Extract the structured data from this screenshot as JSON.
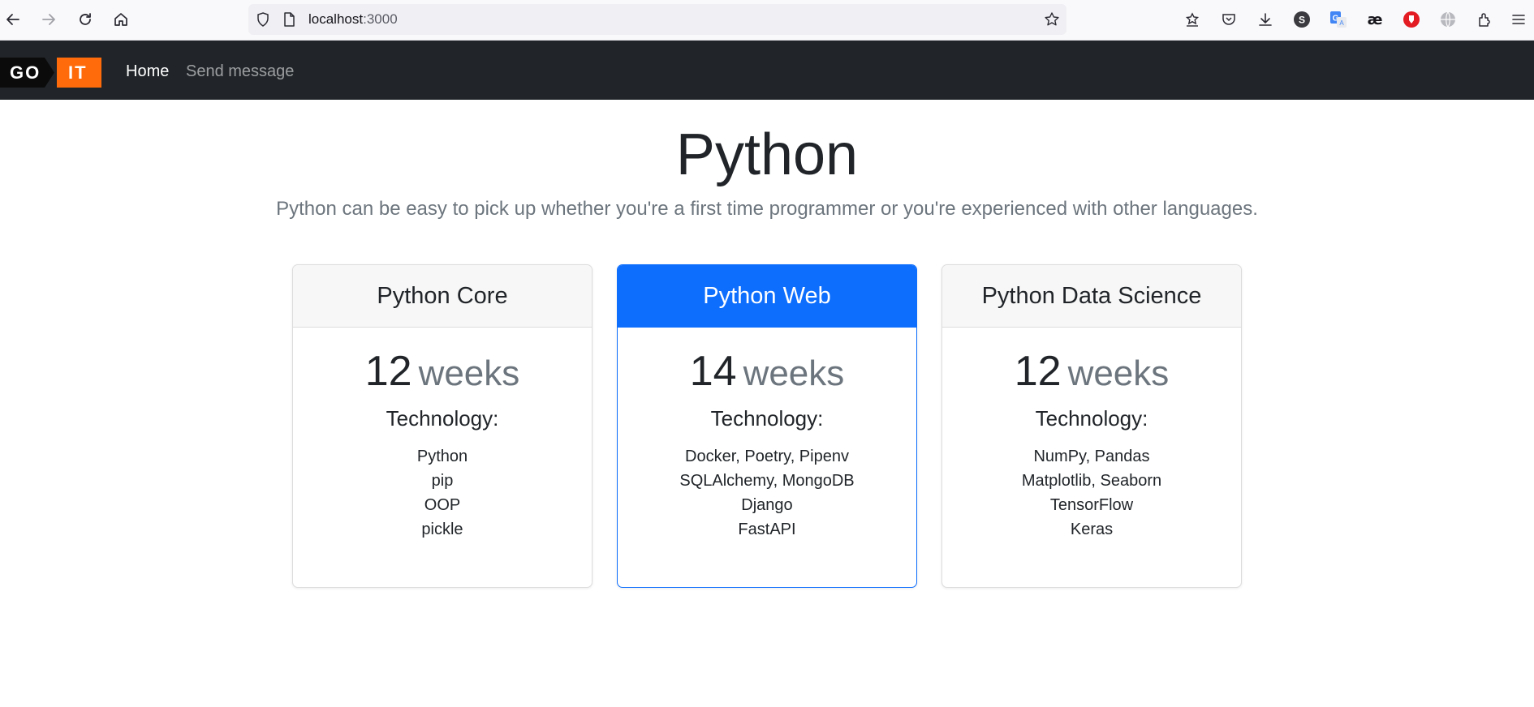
{
  "browser": {
    "url_host": "localhost",
    "url_port": ":3000"
  },
  "navbar": {
    "logo_left": "GO",
    "logo_right": "IT",
    "links": [
      {
        "label": "Home"
      },
      {
        "label": "Send message"
      }
    ]
  },
  "hero": {
    "title": "Python",
    "lead": "Python can be easy to pick up whether you're a first time programmer or you're experienced with other languages."
  },
  "cards": [
    {
      "header": "Python Core",
      "duration_value": "12",
      "duration_unit": "weeks",
      "tech_title": "Technology:",
      "tech_items": [
        "Python",
        "pip",
        "OOP",
        "pickle"
      ]
    },
    {
      "header": "Python Web",
      "duration_value": "14",
      "duration_unit": "weeks",
      "tech_title": "Technology:",
      "tech_items": [
        "Docker, Poetry, Pipenv",
        "SQLAlchemy, MongoDB",
        "Django",
        "FastAPI"
      ]
    },
    {
      "header": "Python Data Science",
      "duration_value": "12",
      "duration_unit": "weeks",
      "tech_title": "Technology:",
      "tech_items": [
        "NumPy, Pandas",
        "Matplotlib, Seaborn",
        "TensorFlow",
        "Keras"
      ]
    }
  ],
  "colors": {
    "navbar_bg": "#212529",
    "primary": "#0d6efd",
    "logo_accent": "#ff6b0a"
  },
  "toolbar_icons": [
    "back-icon",
    "forward-icon",
    "reload-icon",
    "home-icon",
    "shield-icon",
    "page-icon",
    "star-icon",
    "bookmarks-icon",
    "pocket-icon",
    "download-icon",
    "extension-s-icon",
    "translate-icon",
    "ae-icon",
    "opera-icon",
    "globe-icon",
    "extensions-icon",
    "menu-icon"
  ]
}
